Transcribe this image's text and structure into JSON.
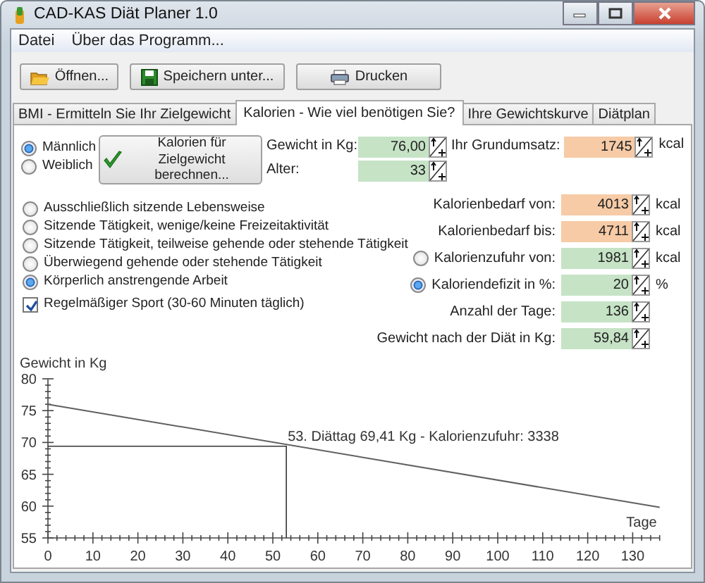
{
  "window": {
    "title": "CAD-KAS Diät Planer 1.0",
    "controls": [
      {
        "kind": "minimize"
      },
      {
        "kind": "maximize"
      },
      {
        "kind": "close"
      }
    ]
  },
  "menu": [
    "Datei",
    "Über das Programm..."
  ],
  "toolbar": [
    {
      "label": "Öffnen...",
      "kind": "open"
    },
    {
      "label": "Speichern unter...",
      "kind": "save"
    },
    {
      "label": "Drucken",
      "kind": "print"
    }
  ],
  "tabs": [
    {
      "label": "BMI - Ermitteln Sie Ihr Zielgewicht",
      "selected": false
    },
    {
      "label": "Kalorien - Wie viel benötigen Sie?",
      "selected": true
    },
    {
      "label": "Ihre Gewichtskurve",
      "selected": false
    },
    {
      "label": "Diätplan",
      "selected": false
    }
  ],
  "gender": [
    {
      "label": "Männlich",
      "selected": true
    },
    {
      "label": "Weiblich",
      "selected": false
    }
  ],
  "calc_button": {
    "label": "Kalorien für Zielgewicht berechnen..."
  },
  "inputs": [
    {
      "label": "Gewicht in Kg:",
      "value": "76,00",
      "color": "#c6e3c6"
    },
    {
      "label": "Alter:",
      "value": "33",
      "color": "#c6e3c6"
    }
  ],
  "basal": {
    "label": "Ihr Grundumsatz:",
    "value": "1745",
    "unit": "kcal",
    "color": "#f6cba6"
  },
  "activity": [
    {
      "label": "Ausschließlich sitzende Lebensweise",
      "selected": false
    },
    {
      "label": "Sitzende Tätigkeit, wenige/keine Freizeitaktivität",
      "selected": false
    },
    {
      "label": "Sitzende Tätigkeit, teilweise gehende oder stehende Tätigkeit",
      "selected": false
    },
    {
      "label": "Überwiegend gehende oder stehende Tätigkeit",
      "selected": false
    },
    {
      "label": "Körperlich anstrengende Arbeit",
      "selected": true
    }
  ],
  "sport": {
    "label": "Regelmäßiger Sport (30-60 Minuten täglich)",
    "checked": true
  },
  "results": [
    {
      "kind": "plain",
      "label": "Kalorienbedarf von:",
      "value": "4013",
      "unit": "kcal",
      "color": "#f6cba6"
    },
    {
      "kind": "plain",
      "label": "Kalorienbedarf bis:",
      "value": "4711",
      "unit": "kcal",
      "color": "#f6cba6"
    },
    {
      "kind": "radio",
      "label": "Kalorienzufuhr von:",
      "value": "1981",
      "unit": "kcal",
      "color": "#c6e3c6",
      "selected": false
    },
    {
      "kind": "radio",
      "label": "Kaloriendefizit in %:",
      "value": "20",
      "unit": "%",
      "color": "#c6e3c6",
      "selected": true
    },
    {
      "kind": "plain",
      "label": "Anzahl der Tage:",
      "value": "136",
      "color": "#c6e3c6"
    },
    {
      "kind": "plain",
      "label": "Gewicht nach der Diät in Kg:",
      "value": "59,84",
      "color": "#c6e3c6"
    }
  ],
  "chart": {
    "chart_data": {
      "type": "line",
      "ylabel": "Gewicht in Kg",
      "xlabel": "Tage",
      "x": [
        0,
        136
      ],
      "series": [
        {
          "color": "#606060",
          "values": [
            76.0,
            59.8
          ]
        }
      ],
      "xlim": [
        0,
        136
      ],
      "ylim": [
        55,
        80
      ],
      "xticks": [
        0,
        10,
        20,
        30,
        40,
        50,
        60,
        70,
        80,
        90,
        100,
        110,
        120,
        130
      ],
      "yticks": [
        55,
        60,
        65,
        70,
        75,
        80
      ],
      "annotations": [
        {
          "x": 53,
          "y": 69.41,
          "text": "53. Diättag 69,41 Kg - Kalorienzufuhr: 3338"
        }
      ]
    }
  }
}
